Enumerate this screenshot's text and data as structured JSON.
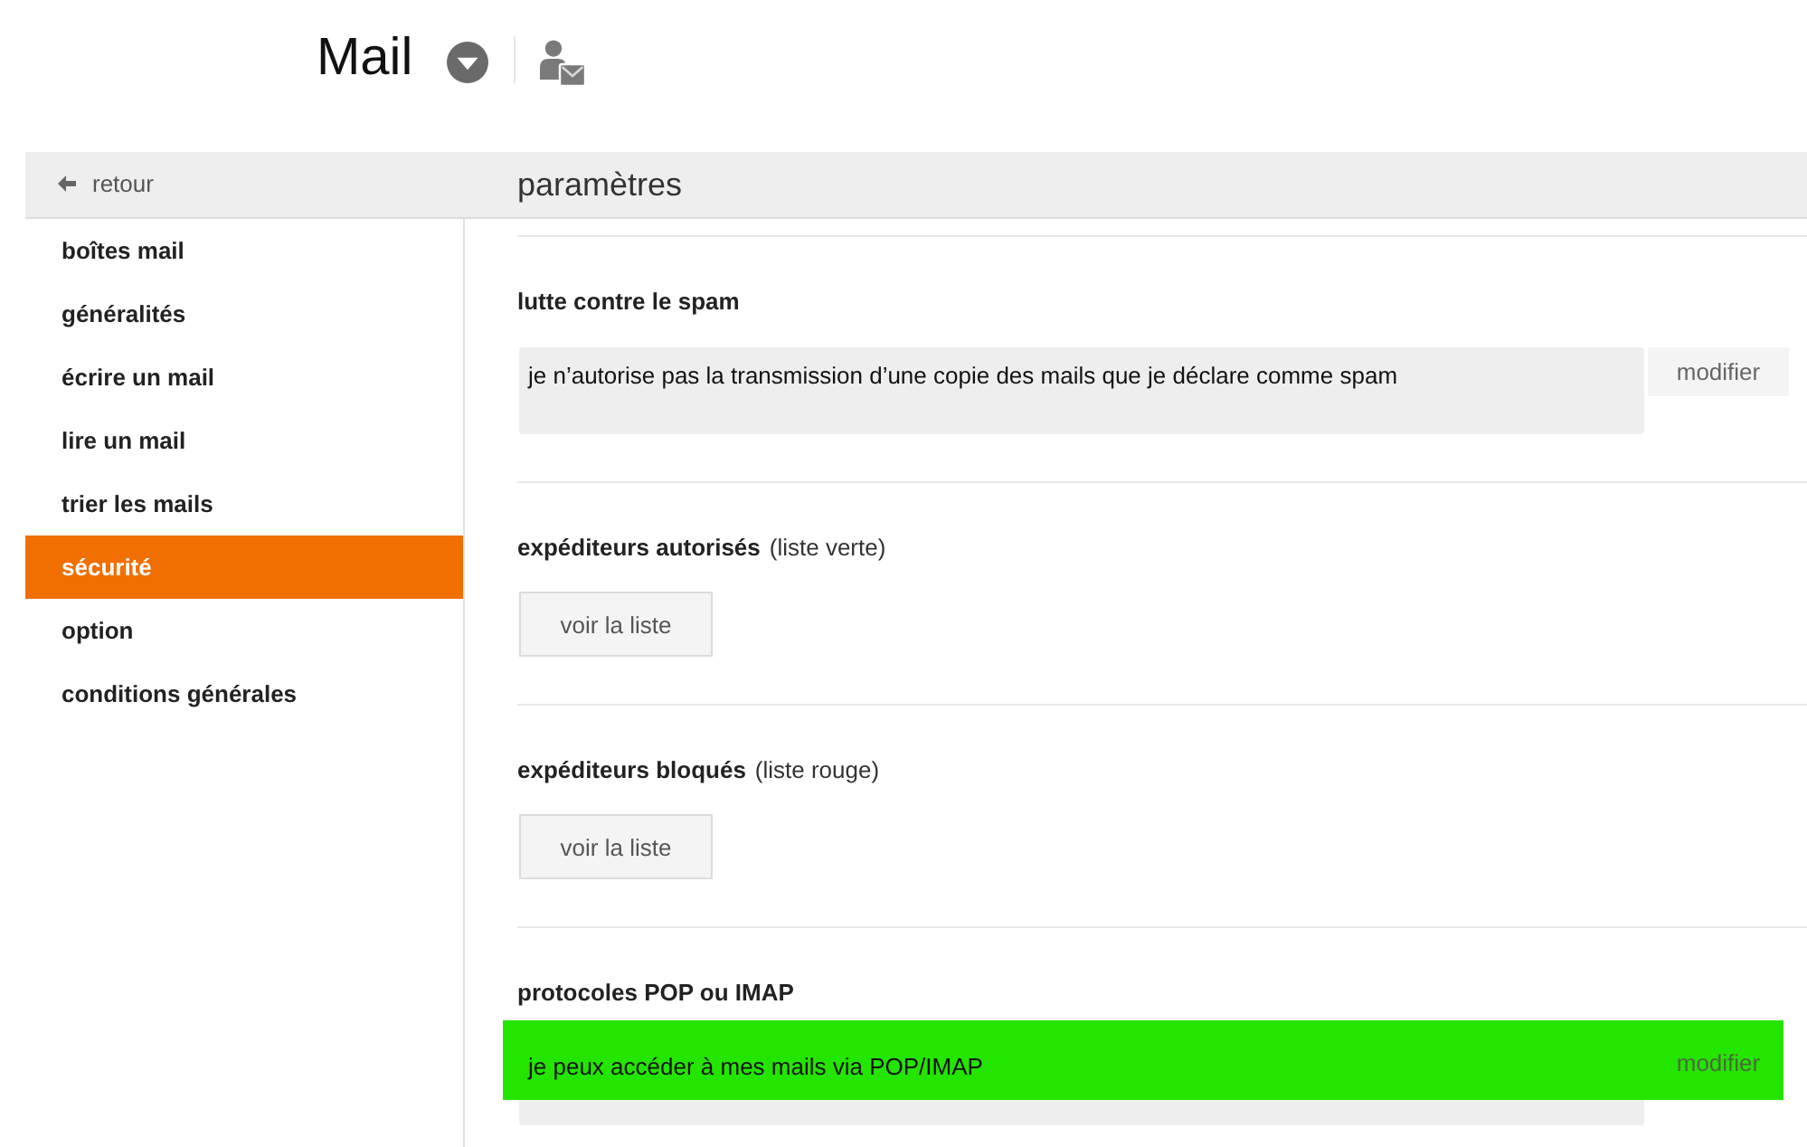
{
  "header": {
    "title": "Mail"
  },
  "nav": {
    "back": "retour",
    "title": "paramètres"
  },
  "sidebar": {
    "items": [
      {
        "label": "boîtes mail",
        "selected": false
      },
      {
        "label": "généralités",
        "selected": false
      },
      {
        "label": "écrire un mail",
        "selected": false
      },
      {
        "label": "lire un mail",
        "selected": false
      },
      {
        "label": "trier les mails",
        "selected": false
      },
      {
        "label": "sécurité",
        "selected": true
      },
      {
        "label": "option",
        "selected": false
      },
      {
        "label": "conditions générales",
        "selected": false
      }
    ]
  },
  "sections": [
    {
      "kind": "setting",
      "title": "lutte contre le spam",
      "value": "je n’autorise pas la transmission d’une copie des mails que je déclare comme spam",
      "button": "modifier",
      "highlighted": false
    },
    {
      "kind": "list",
      "title": "expéditeurs autorisés",
      "note": "(liste verte)",
      "button": "voir la liste"
    },
    {
      "kind": "list",
      "title": "expéditeurs bloqués",
      "note": "(liste rouge)",
      "button": "voir la liste"
    },
    {
      "kind": "setting",
      "title": "protocoles POP ou IMAP",
      "value": "je peux accéder à mes mails via POP/IMAP",
      "button": "modifier",
      "highlighted": true
    }
  ]
}
